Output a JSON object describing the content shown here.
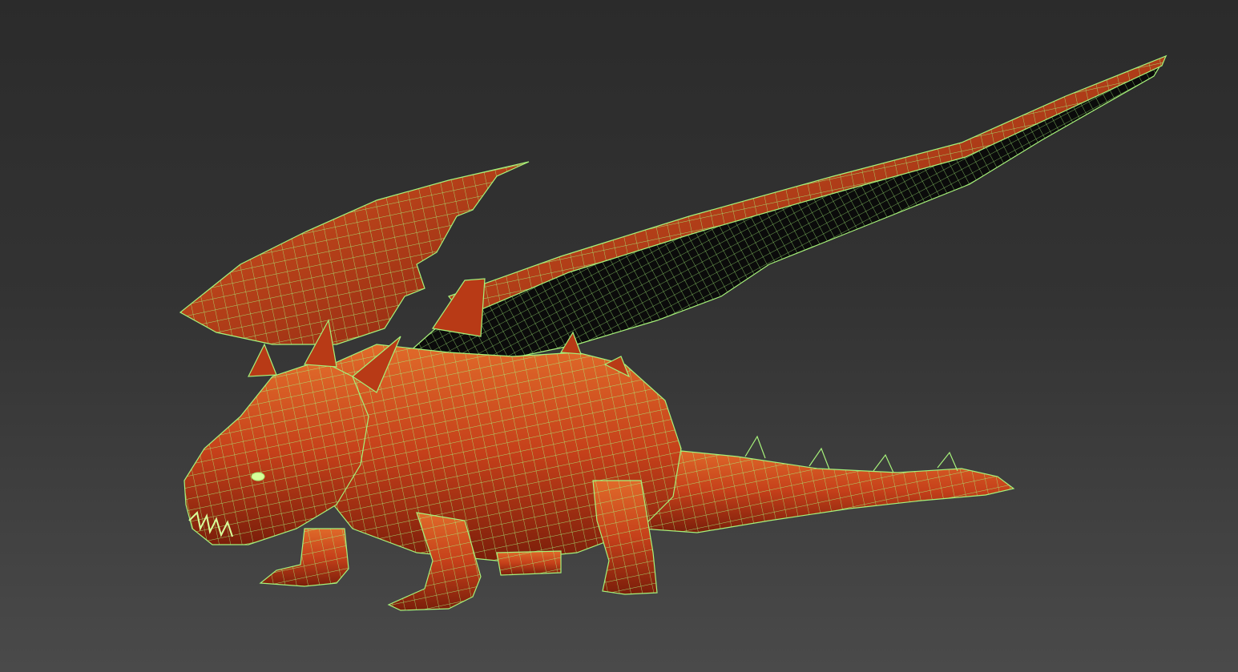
{
  "viewport": {
    "background_top": "#2b2b2b",
    "background_bottom": "#4a4a4a",
    "display_mode": "wireframe-on-shaded"
  },
  "model": {
    "subject": "dragon",
    "skin_color": "#c5401a",
    "skin_highlight": "#e4702a",
    "skin_shadow": "#7a1e0a",
    "wing_membrane_color": "#0b0b0b",
    "wireframe_color": "#a6f27a"
  }
}
